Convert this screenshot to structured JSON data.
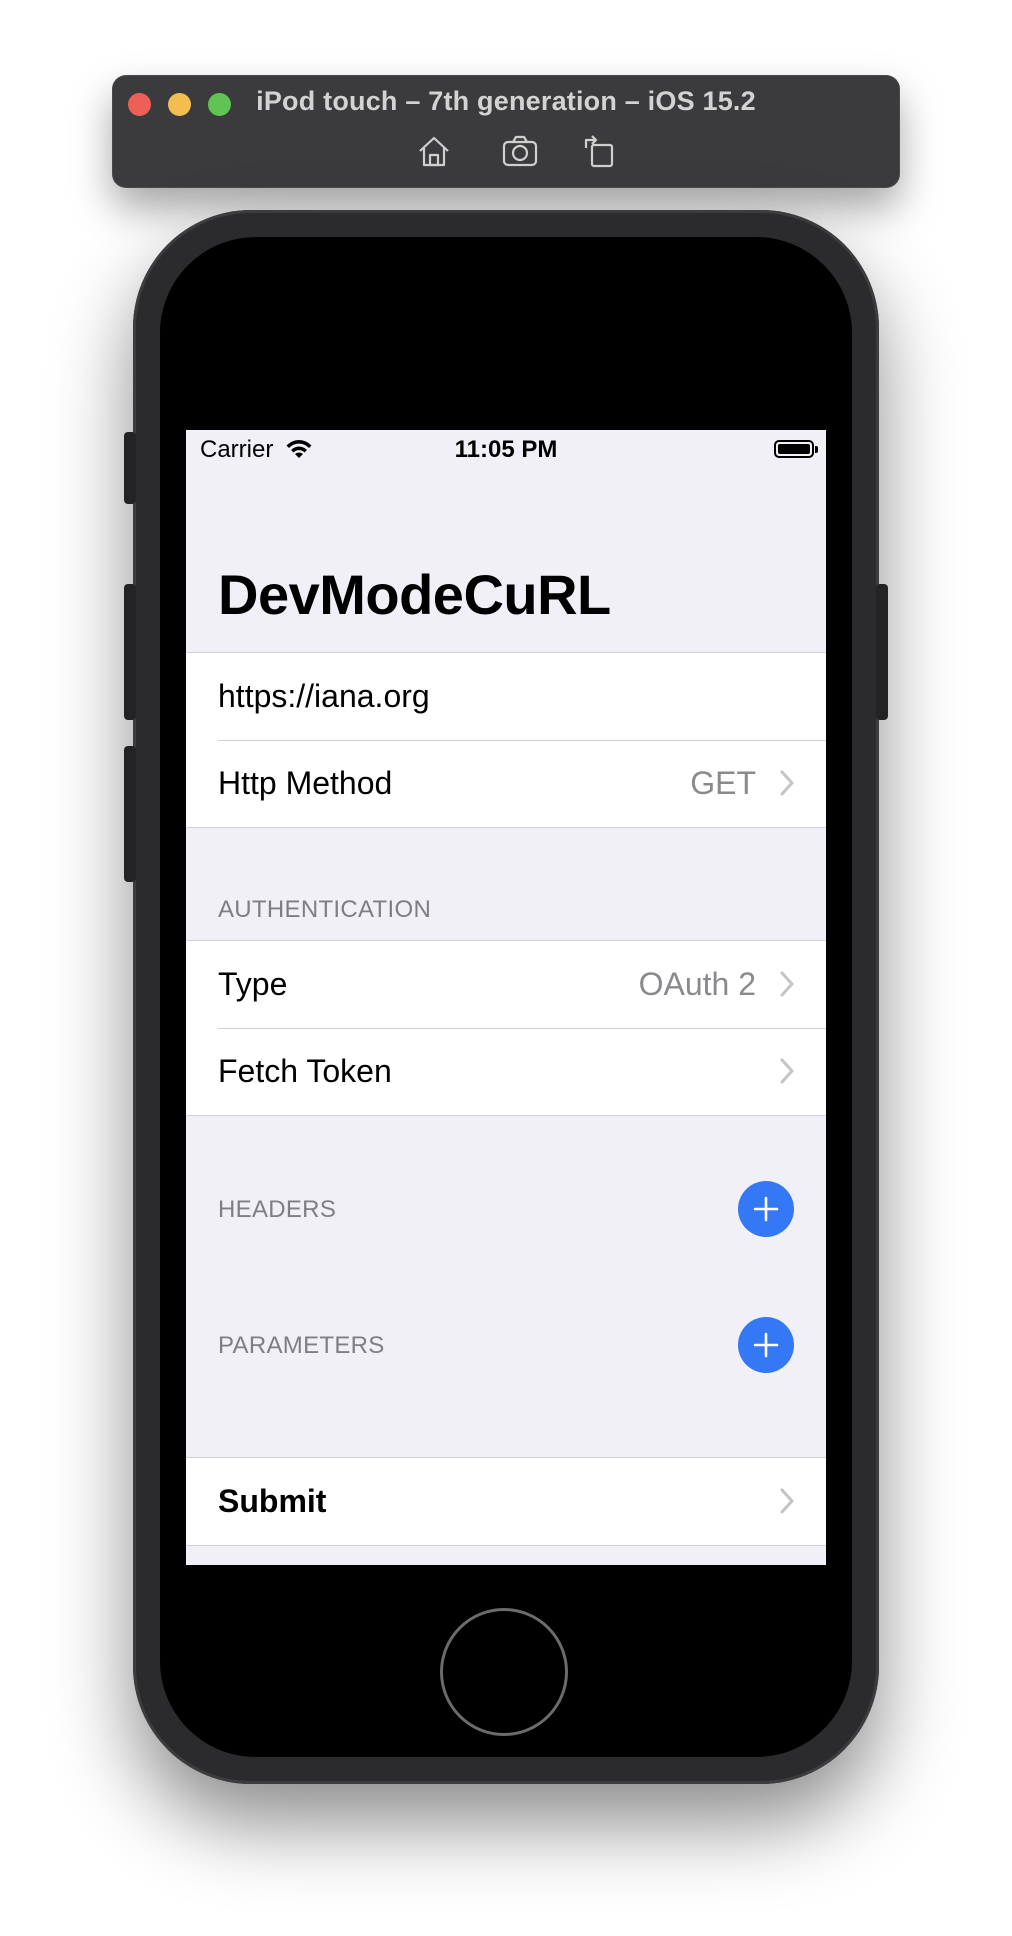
{
  "simulator": {
    "title": "iPod touch – 7th generation – iOS 15.2",
    "toolbar": [
      "home-icon",
      "screenshot-icon",
      "rotate-icon"
    ]
  },
  "status_bar": {
    "carrier": "Carrier",
    "time": "11:05 PM"
  },
  "app": {
    "title": "DevModeCuRL",
    "url_field": {
      "value": "https://iana.org"
    },
    "method_row": {
      "label": "Http Method",
      "value": "GET"
    },
    "auth_section": {
      "header": "AUTHENTICATION",
      "type_row": {
        "label": "Type",
        "value": "OAuth 2"
      },
      "fetch_row": {
        "label": "Fetch Token"
      }
    },
    "headers_section": {
      "header": "HEADERS"
    },
    "parameters_section": {
      "header": "PARAMETERS"
    },
    "submit_row": {
      "label": "Submit"
    }
  },
  "colors": {
    "accent": "#3478f6",
    "background": "#f1f0f6",
    "secondary_text": "#8a8a8e"
  }
}
